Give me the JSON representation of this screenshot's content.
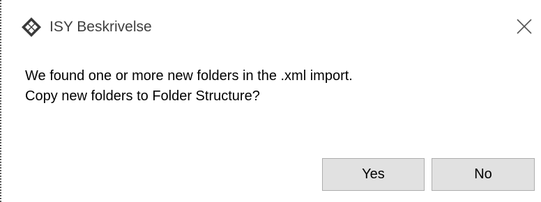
{
  "window": {
    "title": "ISY Beskrivelse",
    "icon": "isy-diamond-logo-icon",
    "close_icon": "close-icon"
  },
  "message": {
    "line1": "We found one or more new folders in the .xml import.",
    "line2": "Copy new folders to Folder Structure?"
  },
  "buttons": {
    "yes_label": "Yes",
    "no_label": "No"
  },
  "colors": {
    "button_bg": "#e1e1e1",
    "button_border": "#adadad",
    "title_text": "#3f3f3f"
  }
}
